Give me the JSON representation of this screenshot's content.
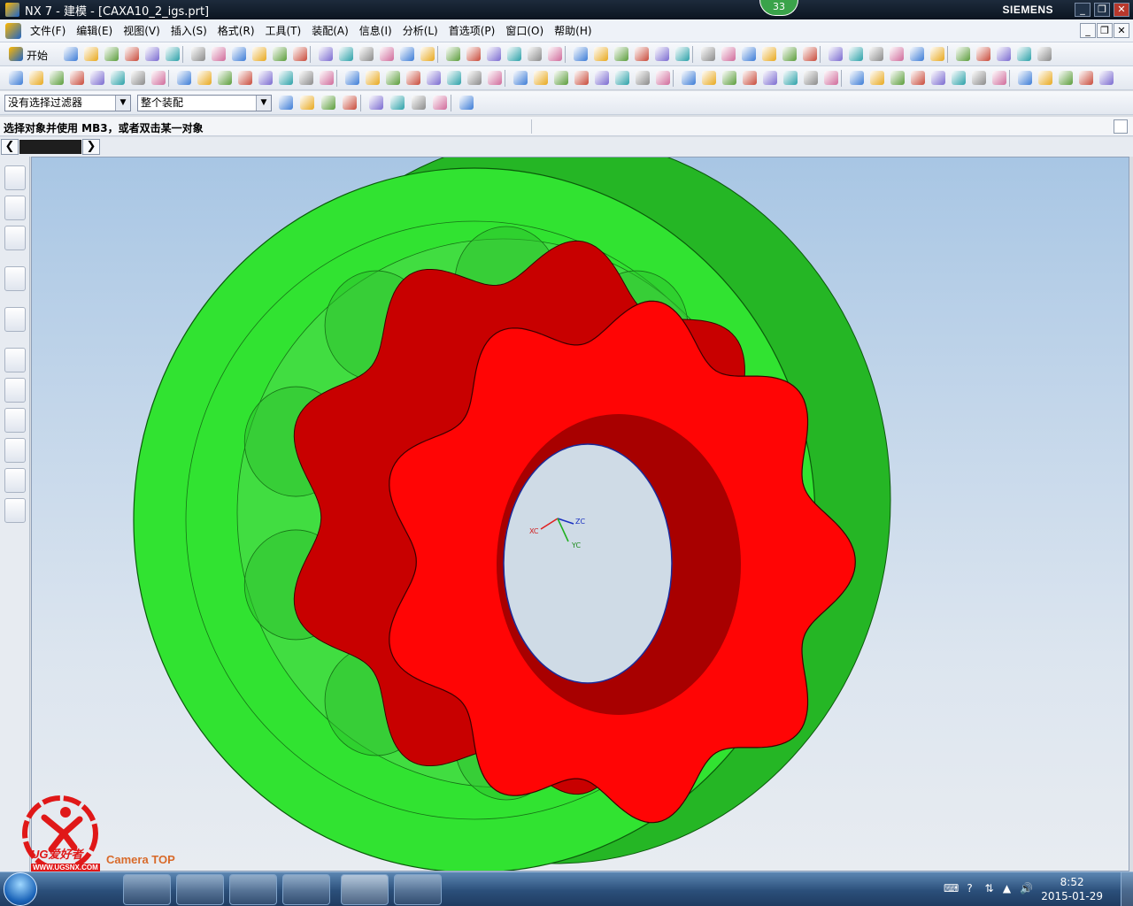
{
  "window": {
    "title": "NX 7 - 建模 - [CAXA10_2_igs.prt]",
    "brand": "SIEMENS",
    "badge": "33"
  },
  "menu": {
    "items": [
      "文件(F)",
      "编辑(E)",
      "视图(V)",
      "插入(S)",
      "格式(R)",
      "工具(T)",
      "装配(A)",
      "信息(I)",
      "分析(L)",
      "首选项(P)",
      "窗口(O)",
      "帮助(H)"
    ]
  },
  "toolbar": {
    "start_label": "开始",
    "selection_filter": "没有选择过滤器",
    "assembly_scope": "整个装配"
  },
  "cue_line": {
    "text": "选择对象并使用 MB3，或者双击某一对象"
  },
  "viewport": {
    "view_label": "Camera TOP",
    "wcs_labels": [
      "XC",
      "YC",
      "ZC"
    ],
    "colors": {
      "ring": "#2ee82e",
      "gear": "#ff0000",
      "background_top": "#a8c6e4",
      "background_bottom": "#e8ecf1"
    }
  },
  "watermark": {
    "text": "UG爱好者",
    "url": "WWW.UGSNX.COM"
  },
  "taskbar": {
    "time": "8:52",
    "date": "2015-01-29",
    "apps": [
      "paint-icon",
      "calculator-icon",
      "refresh-icon",
      "folder-icon",
      "nx-icon",
      "picture-icon"
    ]
  }
}
